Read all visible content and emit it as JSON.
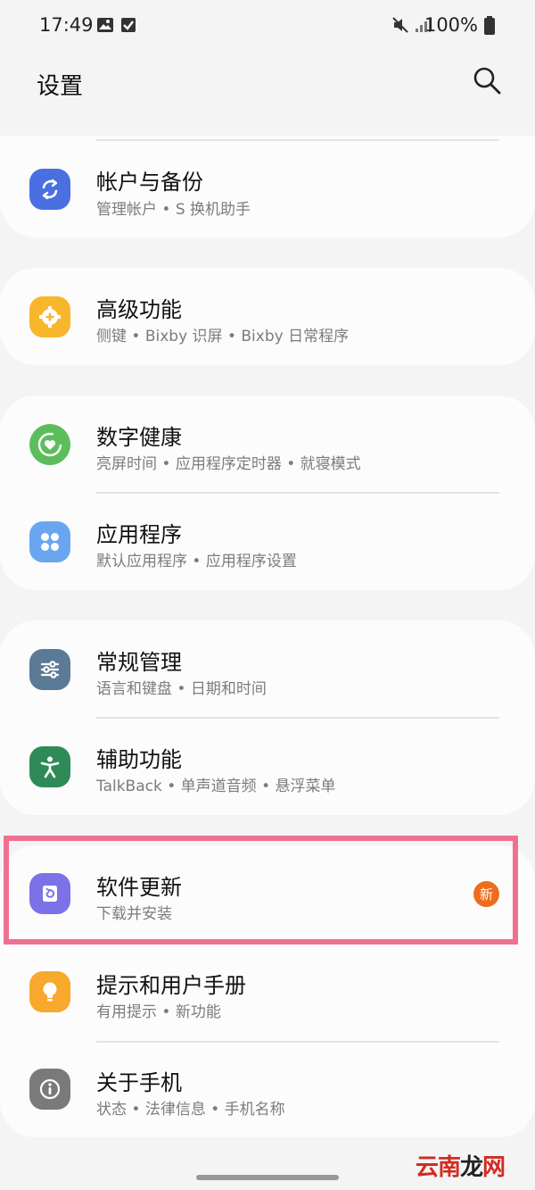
{
  "status_bar": {
    "time": "17:49",
    "battery": "100%",
    "icons": [
      "image-icon",
      "check-box-icon",
      "mute-icon",
      "signal-icon",
      "battery-icon"
    ]
  },
  "header": {
    "title": "设置",
    "search_icon": "search-icon"
  },
  "items": [
    {
      "title": "帐户与备份",
      "subtitle": "管理帐户 • S 换机助手",
      "icon": "sync-icon",
      "color": "#4a6fe0"
    },
    {
      "title": "高级功能",
      "subtitle": "侧键 • Bixby 识屏 • Bixby 日常程序",
      "icon": "gear-plus-icon",
      "color": "#f8b62d"
    },
    {
      "title": "数字健康",
      "subtitle": "亮屏时间 • 应用程序定时器 • 就寝模式",
      "icon": "heart-circle-icon",
      "color": "#5dbd5d"
    },
    {
      "title": "应用程序",
      "subtitle": "默认应用程序 • 应用程序设置",
      "icon": "grid-dots-icon",
      "color": "#6aa6f0"
    },
    {
      "title": "常规管理",
      "subtitle": "语言和键盘 • 日期和时间",
      "icon": "sliders-icon",
      "color": "#5b7a96"
    },
    {
      "title": "辅助功能",
      "subtitle": "TalkBack • 单声道音频 • 悬浮菜单",
      "icon": "accessibility-icon",
      "color": "#2e8b57"
    },
    {
      "title": "软件更新",
      "subtitle": "下载并安装",
      "icon": "software-update-icon",
      "color": "#7b72e8",
      "badge": "新"
    },
    {
      "title": "提示和用户手册",
      "subtitle": "有用提示 • 新功能",
      "icon": "lightbulb-icon",
      "color": "#f8a82d"
    },
    {
      "title": "关于手机",
      "subtitle": "状态 • 法律信息 • 手机名称",
      "icon": "info-icon",
      "color": "#7a7a7a"
    }
  ],
  "watermark": {
    "part1": "云南",
    "part2": "龙",
    "part3": "网"
  },
  "colors": {
    "background": "#f4f4f4",
    "card": "#fcfcfc",
    "highlight": "#f0708f",
    "badge": "#ee6c1b"
  }
}
